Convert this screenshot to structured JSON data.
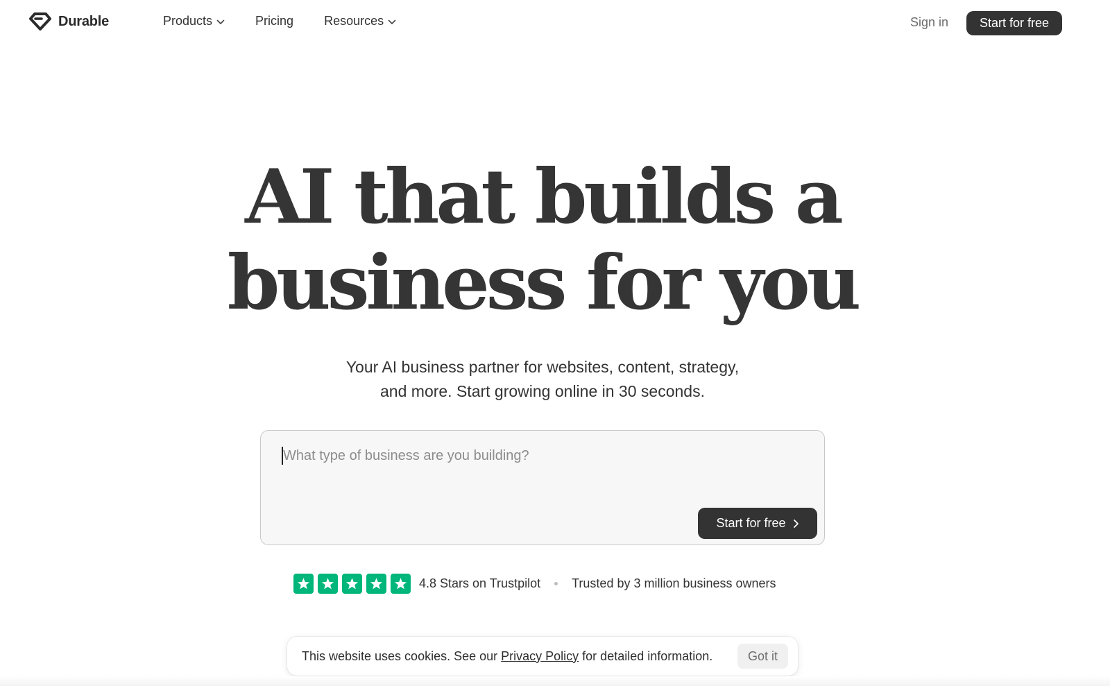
{
  "brand": {
    "name": "Durable",
    "logo_icon": "diamond-logo-icon"
  },
  "nav": {
    "items": [
      {
        "label": "Products",
        "has_dropdown": true
      },
      {
        "label": "Pricing",
        "has_dropdown": false
      },
      {
        "label": "Resources",
        "has_dropdown": true
      }
    ]
  },
  "header": {
    "signin_label": "Sign in",
    "cta_label": "Start for free"
  },
  "hero": {
    "title_line1": "AI that builds a",
    "title_line2": "business for you",
    "subtitle_line1": "Your AI business partner for websites, content, strategy,",
    "subtitle_line2": "and more. Start growing online in 30 seconds."
  },
  "prompt": {
    "placeholder": "What type of business are you building?",
    "value": "",
    "cta_label": "Start for free",
    "cta_icon": "chevron-right-icon"
  },
  "trust": {
    "stars": 5,
    "rating_text": "4.8 Stars on Trustpilot",
    "trusted_text": "Trusted by 3 million business owners",
    "star_color": "#00b67a"
  },
  "cookie": {
    "text_before": "This website uses cookies. See our",
    "link_label": "Privacy Policy",
    "text_after": "for detailed information.",
    "button_label": "Got it"
  },
  "colors": {
    "primary_dark": "#333333",
    "background": "#ffffff",
    "input_bg": "#f7f7f7"
  }
}
